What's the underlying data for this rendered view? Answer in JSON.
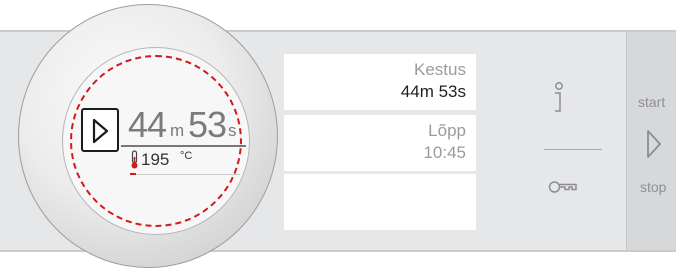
{
  "program": {
    "duration_minutes": "44",
    "minutes_unit": "m",
    "duration_seconds": "53",
    "seconds_unit": "s",
    "temperature": "195",
    "temperature_unit": "°C",
    "progress_fraction": 0.05
  },
  "info_panel": {
    "duration_label": "Kestus",
    "duration_value": "44m 53s",
    "end_label": "Lõpp",
    "end_value": "10:45"
  },
  "controls": {
    "start_label": "start",
    "stop_label": "stop"
  },
  "icons": {
    "info": "info-icon",
    "key": "key-icon",
    "play": "play-icon",
    "thermometer": "thermometer-icon"
  },
  "colors": {
    "accent": "#d11a1a",
    "panel": "#e6e7e9"
  }
}
